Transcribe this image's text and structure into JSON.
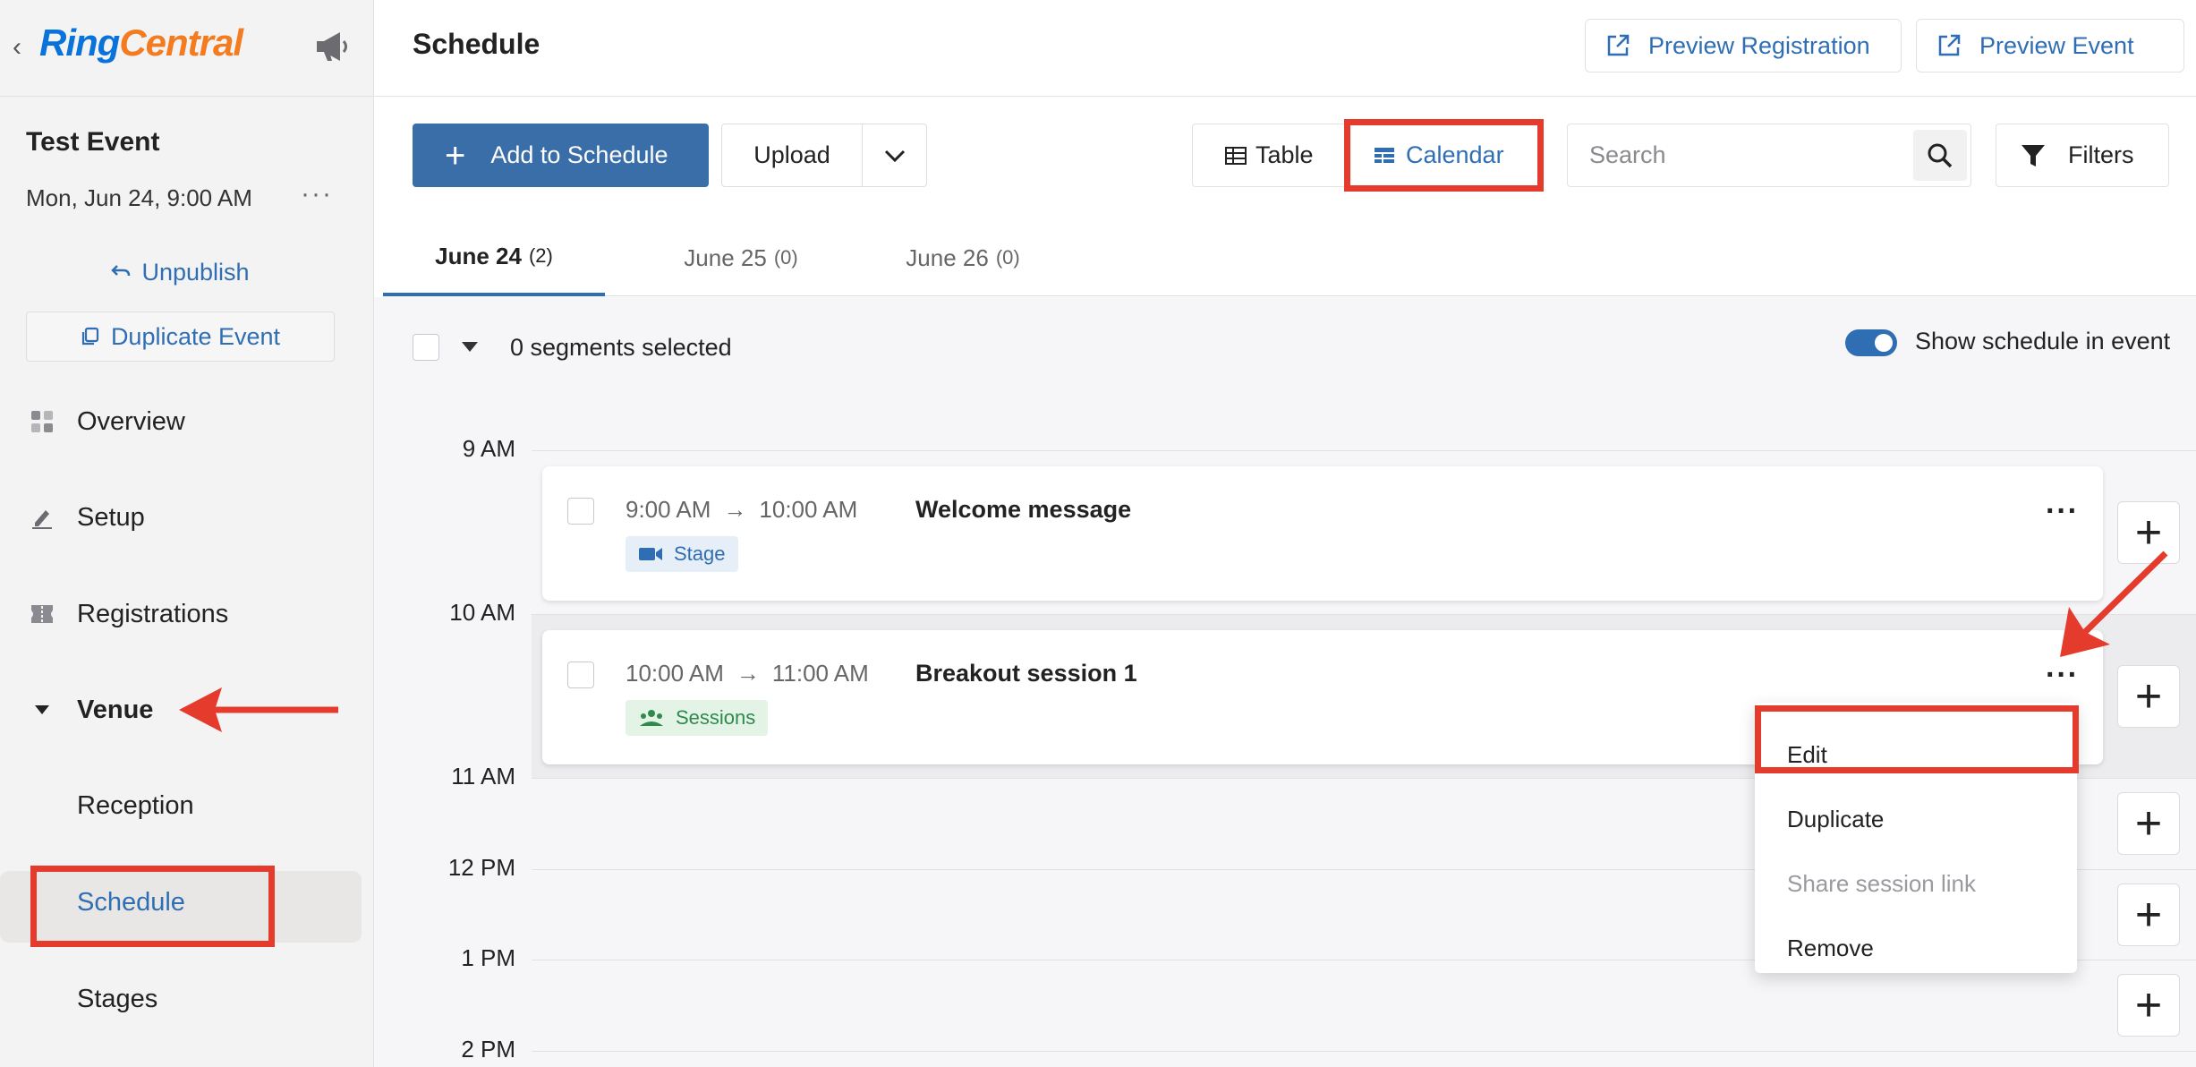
{
  "sidebar": {
    "back": "‹",
    "logo_ring": "Ring",
    "logo_central": "Central",
    "event_title": "Test Event",
    "event_date": "Mon, Jun 24, 9:00 AM",
    "more": "···",
    "unpublish_label": "Unpublish",
    "duplicate_label": "Duplicate Event",
    "nav": {
      "overview": "Overview",
      "setup": "Setup",
      "registrations": "Registrations",
      "venue": "Venue",
      "reception": "Reception",
      "schedule": "Schedule",
      "stages": "Stages"
    }
  },
  "header": {
    "title": "Schedule",
    "preview_registration": "Preview Registration",
    "preview_event": "Preview Event"
  },
  "toolbar": {
    "add_label": "Add to Schedule",
    "add_plus": "+",
    "upload_label": "Upload",
    "view_table": "Table",
    "view_calendar": "Calendar",
    "search_placeholder": "Search",
    "filters_label": "Filters"
  },
  "tabs": [
    {
      "label": "June 24",
      "count": "(2)"
    },
    {
      "label": "June 25",
      "count": "(0)"
    },
    {
      "label": "June 26",
      "count": "(0)"
    }
  ],
  "selection": {
    "segments_selected": "0 segments selected",
    "show_schedule": "Show schedule in event",
    "show_schedule_enabled": true
  },
  "time_labels": [
    "9 AM",
    "10 AM",
    "11 AM",
    "12 PM",
    "1 PM",
    "2 PM"
  ],
  "segments": [
    {
      "start": "9:00 AM",
      "arrow": "→",
      "end": "10:00 AM",
      "title": "Welcome message",
      "tag": "Stage",
      "more": "···"
    },
    {
      "start": "10:00 AM",
      "arrow": "→",
      "end": "11:00 AM",
      "title": "Breakout session 1",
      "tag": "Sessions",
      "more": "···"
    }
  ],
  "add_slot_plus": "+",
  "context_menu": {
    "edit": "Edit",
    "duplicate": "Duplicate",
    "share": "Share session link",
    "remove": "Remove"
  },
  "colors": {
    "primary": "#3a6ea8",
    "link": "#2f6eb3",
    "annotation": "#e53b2c",
    "logo_blue": "#0a73d9",
    "logo_orange": "#f47c20"
  }
}
